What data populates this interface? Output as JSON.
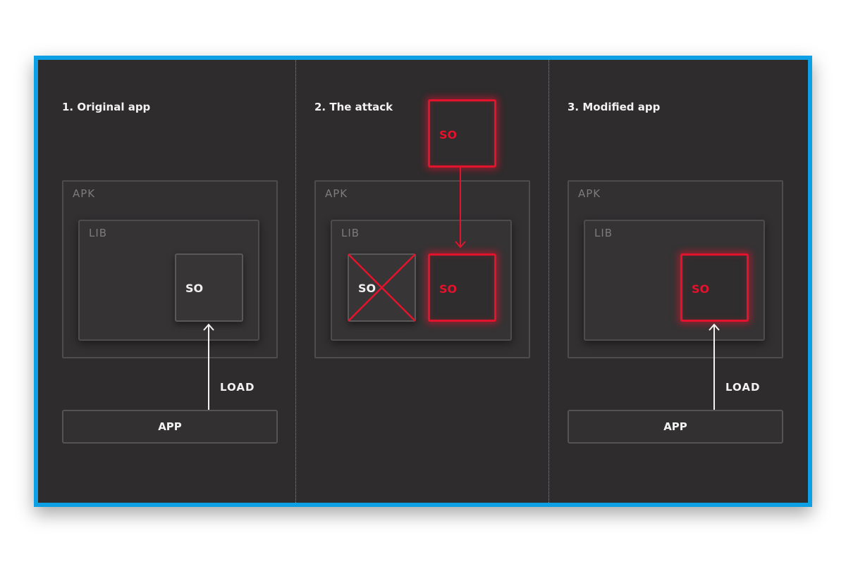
{
  "panels": [
    {
      "title": "1. Original app",
      "apk_label": "APK",
      "lib_label": "LIB",
      "so_label": "SO",
      "load_label": "LOAD",
      "app_label": "APP"
    },
    {
      "title": "2. The attack",
      "apk_label": "APK",
      "lib_label": "LIB",
      "incoming_so_label": "SO",
      "original_so_label": "SO",
      "replacement_so_label": "SO"
    },
    {
      "title": "3. Modified app",
      "apk_label": "APK",
      "lib_label": "LIB",
      "so_label": "SO",
      "load_label": "LOAD",
      "app_label": "APP"
    }
  ],
  "colors": {
    "frame_border": "#0da0e4",
    "background": "#2e2c2d",
    "malicious": "#e3132d",
    "text": "#f2f2f2",
    "muted_text": "#7d7b7c"
  },
  "icons": [
    "arrow-up-icon",
    "arrow-down-icon",
    "cross-icon"
  ]
}
